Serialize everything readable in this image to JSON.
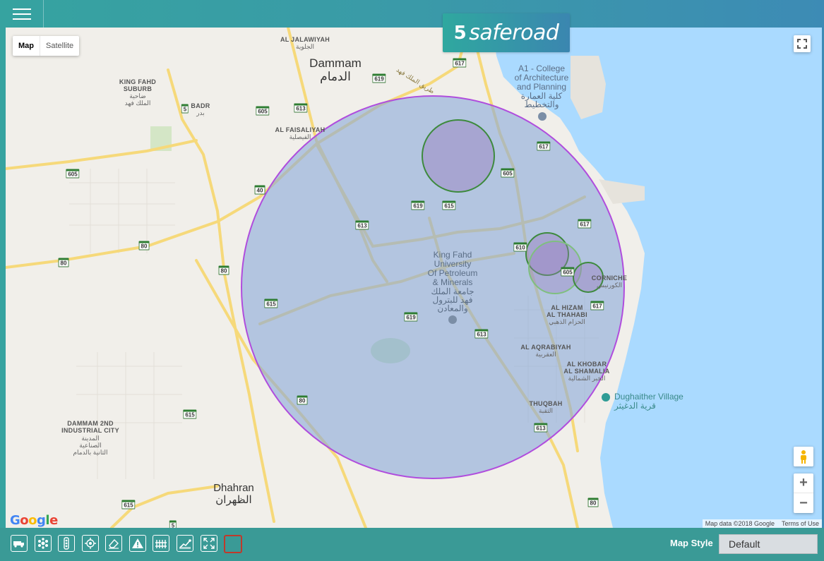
{
  "app": {
    "brand": "saferoad",
    "brand_mark": "5"
  },
  "map_controls": {
    "map_type": [
      {
        "label": "Map"
      },
      {
        "label": "Satellite"
      }
    ],
    "zoom_in": "+",
    "zoom_out": "−"
  },
  "labels": {
    "dammam": "Dammam",
    "dammam_ar": "الدمام",
    "dhahran": "Dhahran",
    "dhahran_ar": "الظهران",
    "al_jalawiyah": "AL JALAWIYAH",
    "al_jalawiyah_ar": "الجلوية",
    "king_fahd_suburb_1": "KING FAHD",
    "king_fahd_suburb_2": "SUBURB",
    "king_fahd_suburb_ar1": "ضاحية",
    "king_fahd_suburb_ar2": "الملك فهد",
    "badr": "BADR",
    "badr_ar": "بدر",
    "al_faisaliyah": "AL FAISALIYAH",
    "al_faisaliyah_ar": "الفيصلية",
    "a1_college_1": "A1 - College",
    "a1_college_2": "of Architecture",
    "a1_college_3": "and Planning",
    "a1_college_ar1": "كلية العمارة",
    "a1_college_ar2": "والتخطيط",
    "kfupm_1": "King Fahd",
    "kfupm_2": "University",
    "kfupm_3": "Of Petroleum",
    "kfupm_4": "& Minerals",
    "kfupm_ar1": "جامعة الملك",
    "kfupm_ar2": "فهد للبترول",
    "kfupm_ar3": "والمعادن",
    "corniche": "CORNICHE",
    "corniche_ar": "الكورنيش",
    "al_hizam_1": "AL HIZAM",
    "al_hizam_2": "AL THAHABI",
    "al_hizam_ar": "الحزام الذهبي",
    "al_aqrabiyah": "AL AQRABIYAH",
    "al_aqrabiyah_ar": "العقربية",
    "al_khobar_1": "AL KHOBAR",
    "al_khobar_2": "AL SHAMALIA",
    "al_khobar_ar": "الخبر الشمالية",
    "dughaither": "Dughaither Village",
    "dughaither_ar": "قرية الدغيثر",
    "thuqbah": "THUQBAH",
    "thuqbah_ar": "الثقبة",
    "dammam2_1": "DAMMAM 2ND",
    "dammam2_2": "INDUSTRIAL CITY",
    "dammam2_ar1": "المدينة",
    "dammam2_ar2": "الصناعية",
    "dammam2_ar3": "الثانية بالدمام",
    "road_ar": "طريق الملك فهد"
  },
  "road_shields": {
    "s617a": "617",
    "s619a": "619",
    "s605a": "605",
    "s613a": "613",
    "s5a": "5",
    "s605b": "605",
    "s617b": "617",
    "s605c": "605",
    "s40": "40",
    "s619b": "619",
    "s615a": "615",
    "s613b": "613",
    "s617c": "617",
    "s610": "610",
    "s80a": "80",
    "s80b": "80",
    "s80c": "80",
    "s605d": "605",
    "s615b": "615",
    "s619c": "619",
    "s617d": "617",
    "s613c": "613",
    "s80d": "80",
    "s615c": "615",
    "s613d": "613",
    "s615d": "615",
    "s5b": "5",
    "s80e": "80"
  },
  "geofence_colors": {
    "large_fill": "#8aa8d8",
    "large_stroke": "#b04ddd",
    "small_fill": "#9a7fbf",
    "small_stroke": "#3d8a3d"
  },
  "attribution": {
    "google": "Google",
    "map_data": "Map data ©2018 Google",
    "terms": "Terms of Use"
  },
  "toolbar": {
    "tools": [
      "vehicles-tool",
      "cluster-tool",
      "traffic-tool",
      "location-tool",
      "eraser-tool",
      "warning-tool",
      "fence-tool",
      "route-tool",
      "fullscreen-tool",
      "empty-tool"
    ],
    "map_style_label": "Map Style",
    "map_style_value": "Default"
  }
}
